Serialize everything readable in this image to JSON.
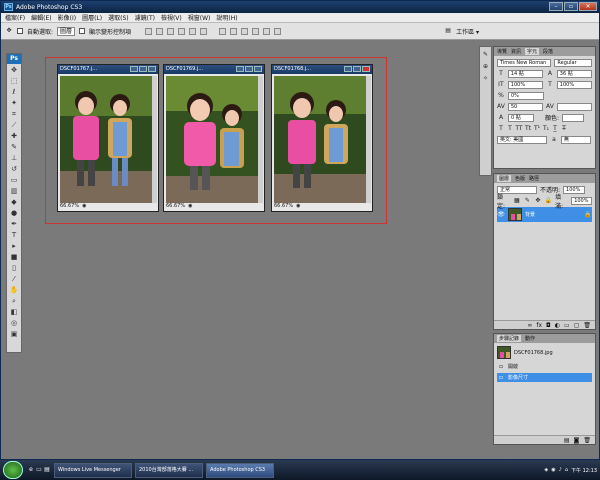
{
  "window": {
    "title": "Adobe Photoshop CS3",
    "app_icon": "ps-icon"
  },
  "menu": [
    "檔案(F)",
    "編輯(E)",
    "影像(I)",
    "圖層(L)",
    "選取(S)",
    "濾鏡(T)",
    "檢視(V)",
    "視窗(W)",
    "說明(H)"
  ],
  "options": {
    "auto_select_label": "自動選取:",
    "auto_select_value": "圖層",
    "show_transform_label": "顯示變形控制項",
    "workspace_label": "工作區 ▾"
  },
  "documents": [
    {
      "title": "DSCF01767.j...",
      "zoom": "66.67%"
    },
    {
      "title": "DSCF01769.j...",
      "zoom": "66.67%"
    },
    {
      "title": "DSCF01768.j...",
      "zoom": "66.67%"
    }
  ],
  "char_panel": {
    "tabs": [
      "導覽",
      "資訊",
      "字元",
      "段落"
    ],
    "font_family": "Times New Roman",
    "font_style": "Regular",
    "font_size": "14 點",
    "leading": "36 點",
    "vscale": "100%",
    "hscale": "100%",
    "tracking": "0%",
    "kerning": "50",
    "baseline": "0 點",
    "color_label": "顏色:",
    "language": "英文: 美國",
    "aa": "a",
    "aa_mode": "無"
  },
  "layers_panel": {
    "tabs": [
      "圖層",
      "色版",
      "路徑"
    ],
    "blend_mode": "正常",
    "opacity_label": "不透明:",
    "opacity": "100%",
    "lock_label": "鎖定:",
    "fill_label": "填滿:",
    "fill": "100%",
    "layer_name": "背景"
  },
  "history_panel": {
    "tabs": [
      "步驟記錄",
      "動作"
    ],
    "snapshot": "DSCF01768.jpg",
    "items": [
      "開啟",
      "影像尺寸"
    ]
  },
  "taskbar": {
    "tasks": [
      "Windows Live Messenger",
      "2010台灣部落格大賽 ...",
      "Adobe Photoshop CS3"
    ],
    "clock": "下午 12:13"
  }
}
